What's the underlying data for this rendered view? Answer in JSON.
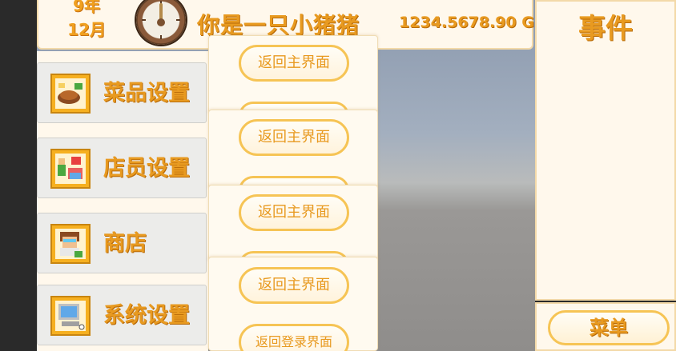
{
  "header": {
    "year": "9年",
    "month": "12月",
    "player_name": "你是一只小猪猪",
    "money": "1234.5678.90 G"
  },
  "event_panel": {
    "title": "事件"
  },
  "menu_button": {
    "label": "菜单"
  },
  "left_menu": {
    "items": [
      {
        "label": "菜品设置",
        "icon": "dish-icon"
      },
      {
        "label": "店员设置",
        "icon": "staff-icon"
      },
      {
        "label": "商店",
        "icon": "shop-icon"
      },
      {
        "label": "系统设置",
        "icon": "computer-icon"
      }
    ]
  },
  "popup_cards": [
    {
      "button_label": "返回主界面"
    },
    {
      "button_label": "返回主界面"
    },
    {
      "button_label": "返回主界面"
    },
    {
      "button_label": "返回主界面",
      "second_button_label": "返回登录界面"
    }
  ],
  "colors": {
    "accent_text": "#e89a20",
    "button_border": "#f6c455",
    "panel_bg": "#fff8ec"
  }
}
